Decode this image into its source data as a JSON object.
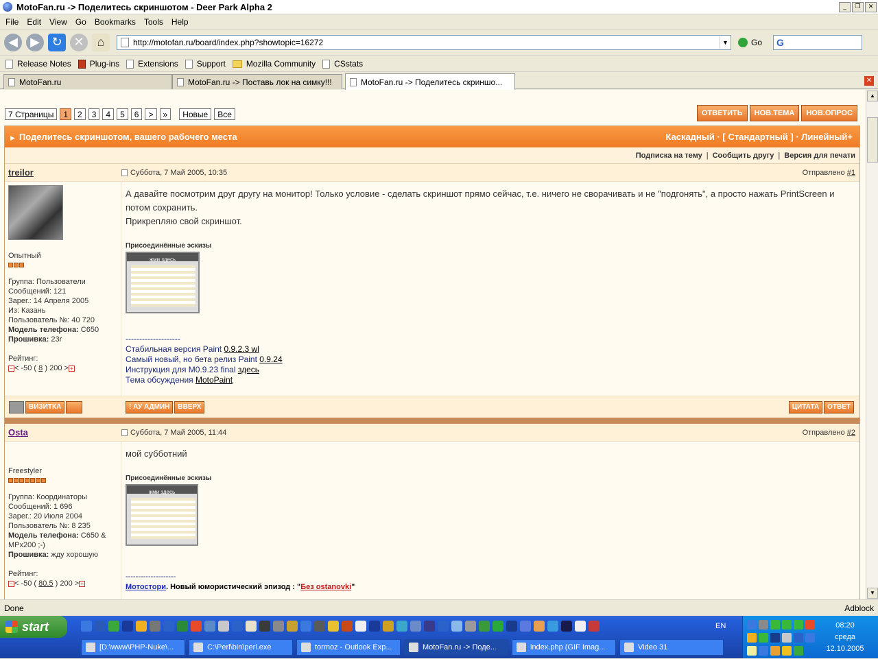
{
  "window": {
    "title": "MotoFan.ru -> Поделитесь скриншотом - Deer Park Alpha 2"
  },
  "menu": [
    "File",
    "Edit",
    "View",
    "Go",
    "Bookmarks",
    "Tools",
    "Help"
  ],
  "nav": {
    "url": "http://motofan.ru/board/index.php?showtopic=16272",
    "go_label": "Go",
    "search_letter": "G"
  },
  "bookmarks": [
    {
      "label": "Release Notes",
      "icon": "page"
    },
    {
      "label": "Plug-ins",
      "icon": "plug"
    },
    {
      "label": "Extensions",
      "icon": "page"
    },
    {
      "label": "Support",
      "icon": "page"
    },
    {
      "label": "Mozilla Community",
      "icon": "folder"
    },
    {
      "label": "CSstats",
      "icon": "page"
    }
  ],
  "tabs": [
    {
      "label": "MotoFan.ru",
      "active": false
    },
    {
      "label": "MotoFan.ru -> Поставь лок на симку!!!",
      "active": false
    },
    {
      "label": "MotoFan.ru -> Поделитесь скриншо...",
      "active": true
    }
  ],
  "pager": {
    "pages_label": "7 Страницы",
    "pages": [
      "1",
      "2",
      "3",
      "4",
      "5",
      "6"
    ],
    "current": "1",
    "next": ">",
    "last": "»",
    "new_label": "Новые",
    "all_label": "Все"
  },
  "actions": [
    "ответить",
    "нов.тема",
    "нов.опрос"
  ],
  "forum": {
    "title": "Поделитесь скриншотом, вашего рабочего места",
    "modes": "Каскадный · [ Стандартный ] · Линейный+",
    "links": [
      "Подписка на тему",
      "Сообщить другу",
      "Версия для печати"
    ]
  },
  "posts": [
    {
      "author": "treilor",
      "date": "Суббота, 7 Май 2005, 10:35",
      "sent_label": "Отправлено",
      "num": "#1",
      "rank": "Опытный",
      "stars": 3,
      "info": [
        "Группа: Пользователи",
        "Сообщений: 121",
        "Зарег.: 14 Апреля 2005",
        "Из: Казань",
        "Пользователь №: 40 720"
      ],
      "phone_label": "Модель телефона:",
      "phone": "C650",
      "fw_label": "Прошивка:",
      "fw": "23r",
      "rating_label": "Рейтинг:",
      "rating_pre": "< -50 (",
      "rating_val": "8",
      "rating_post": ") 200 >",
      "text": [
        "А давайте посмотрим друг другу на монитор! Только условие - сделать скриншот прямо сейчас, т.е. ничего не сворачивать и не \"подгонять\", а просто нажать PrintScreen и потом сохранить.",
        "Прикрепляю свой скриншот."
      ],
      "attach_label": "Присоединённые эскизы",
      "thumb_caption": "жми здесь",
      "sig_sep": "--------------------",
      "sig": [
        {
          "text": "Стабильная версия Paint ",
          "link": "0.9.2.3 wl"
        },
        {
          "text": "Самый новый, но бета релиз Paint ",
          "link": "0.9.24"
        },
        {
          "text": "Инструкция для M0.9.23 final ",
          "link": "здесь"
        },
        {
          "text": "Тема обсуждения ",
          "link": "MotoPaint"
        }
      ],
      "footer_left": [
        "визитка"
      ],
      "footer_mid": [
        "! ау админ",
        "вверх"
      ],
      "footer_right": [
        "цитата",
        "ответ"
      ]
    },
    {
      "author": "Osta",
      "date": "Суббота, 7 Май 2005, 11:44",
      "sent_label": "Отправлено",
      "num": "#2",
      "rank": "Freestyler",
      "stars": 7,
      "info": [
        "Группа: Координаторы",
        "Сообщений: 1 696",
        "Зарег.: 20 Июля 2004",
        "Пользователь №: 8 235"
      ],
      "phone_label": "Модель телефона:",
      "phone": "C650 & MPx200 ;-)",
      "fw_label": "Прошивка:",
      "fw": "жду хорошую",
      "rating_label": "Рейтинг:",
      "rating_pre": "< -50 (",
      "rating_val": "80.5",
      "rating_post": ") 200 >",
      "text": [
        "мой субботний"
      ],
      "attach_label": "Присоединённые эскизы",
      "thumb_caption": "жми здесь",
      "sig_sep": "--------------------",
      "sig_link": "Мотостори",
      "sig_mid": ". Новый юмористический эпизод : \"",
      "sig_link2": "Без ostanovki",
      "sig_end": "\""
    }
  ],
  "status": {
    "left": "Done",
    "right": "Adblock"
  },
  "taskbar": {
    "start_label": "start",
    "tasks": [
      {
        "label": "[D:\\www\\PHP-Nuke\\...",
        "active": false
      },
      {
        "label": "C:\\Perl\\bin\\perl.exe",
        "active": false
      },
      {
        "label": "tormoz - Outlook Exp...",
        "active": false
      },
      {
        "label": "MotoFan.ru -> Поде...",
        "active": true
      },
      {
        "label": "index.php (GIF Imag...",
        "active": false
      },
      {
        "label": "Video 31",
        "active": false
      }
    ],
    "lang": "EN",
    "time": "08:20",
    "day": "среда",
    "date": "12.10.2005"
  }
}
